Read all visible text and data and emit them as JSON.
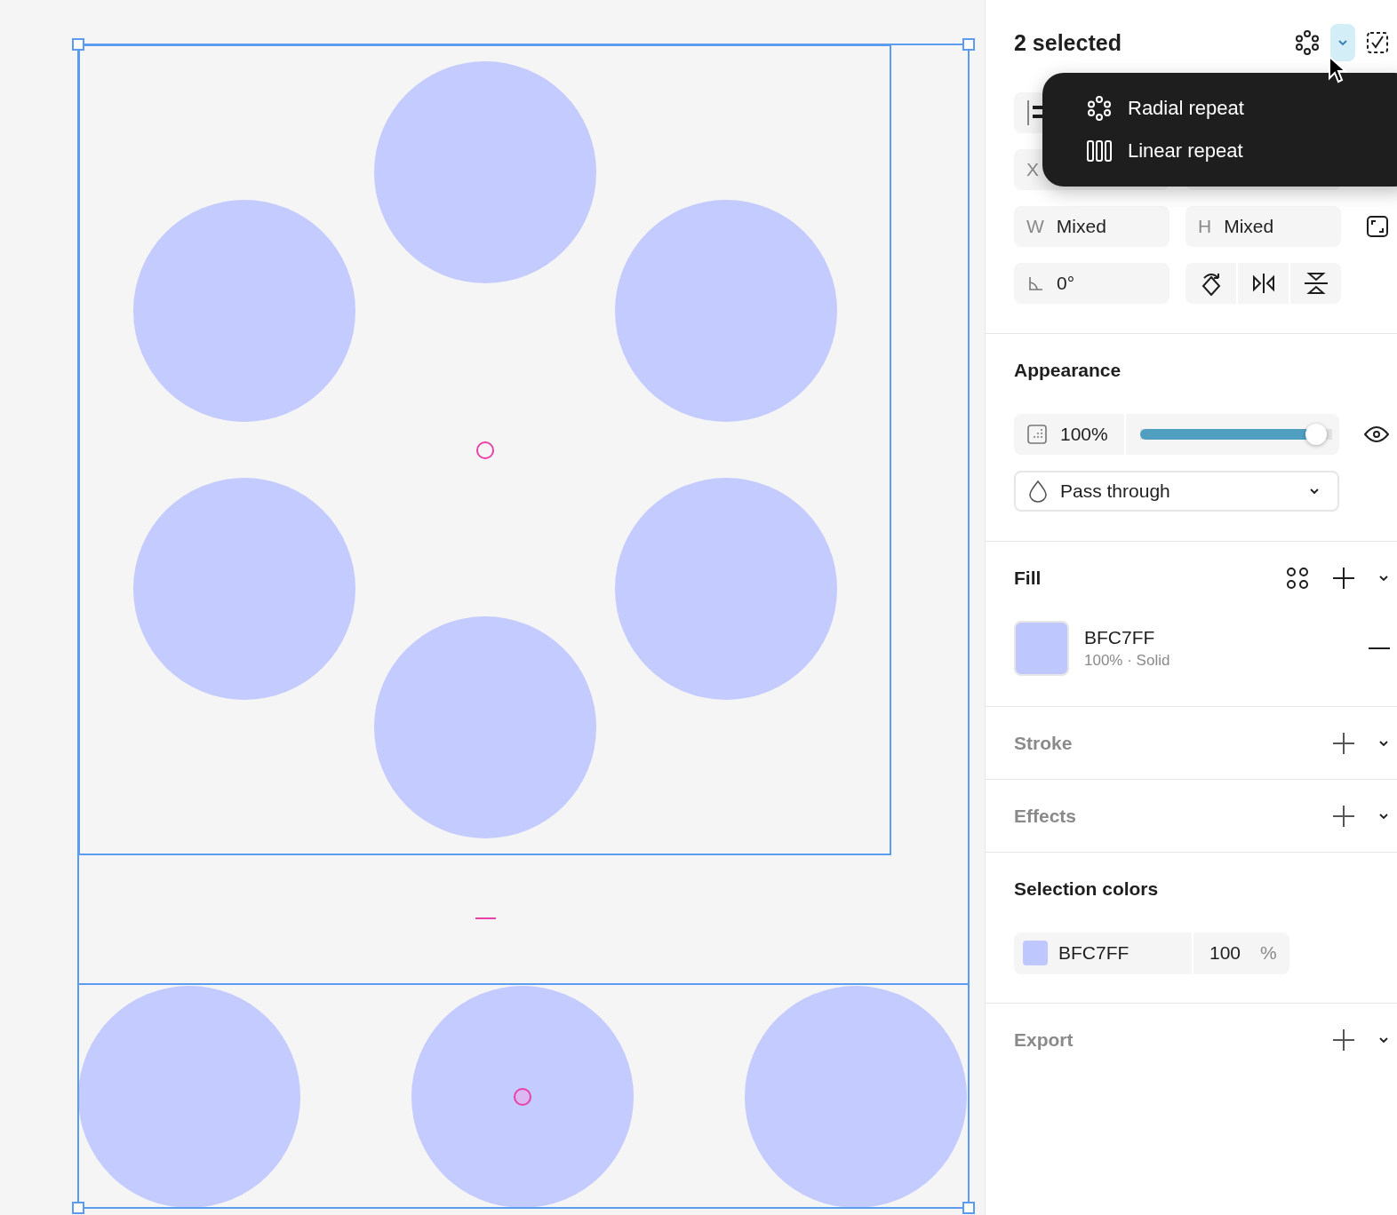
{
  "header": {
    "title": "2 selected",
    "repeat_dropdown": {
      "expanded": true
    }
  },
  "repeat_menu": [
    {
      "label": "Radial repeat",
      "kind": "radial"
    },
    {
      "label": "Linear repeat",
      "kind": "linear"
    }
  ],
  "position": {
    "x_label": "X"
  },
  "size": {
    "w_label": "W",
    "w_value": "Mixed",
    "h_label": "H",
    "h_value": "Mixed"
  },
  "rotation": {
    "value": "0°"
  },
  "sections": [
    {
      "kind": "appearance",
      "title": "Appearance",
      "empty": false,
      "opacity": "100%",
      "level": 0.97,
      "blend": "Pass through"
    },
    {
      "kind": "fill",
      "title": "Fill",
      "empty": false,
      "color": "#bfc7ff",
      "hex": "BFC7FF",
      "detail": "100% · Solid"
    },
    {
      "kind": "collapsed",
      "title": "Stroke",
      "empty": true
    },
    {
      "kind": "collapsed",
      "title": "Effects",
      "empty": true
    },
    {
      "kind": "selection",
      "title": "Selection colors",
      "empty": false,
      "color": "#bfc7ff",
      "hex": "BFC7FF",
      "opacity": "100",
      "unit": "%"
    },
    {
      "kind": "collapsed",
      "title": "Export",
      "empty": true
    }
  ]
}
